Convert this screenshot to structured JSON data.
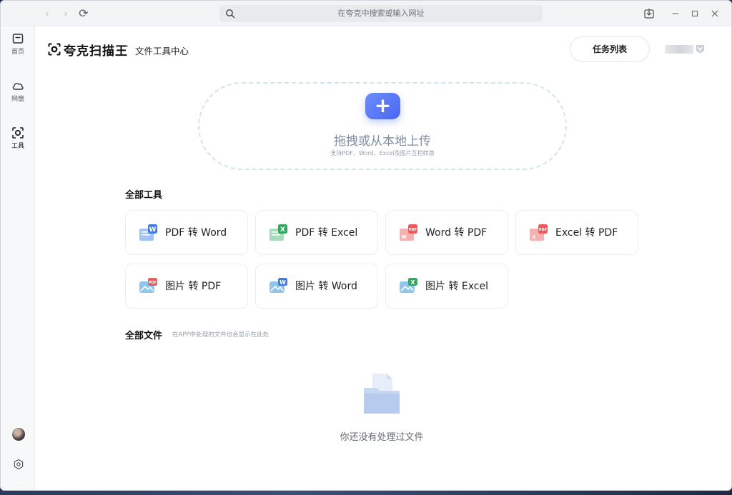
{
  "titlebar": {
    "back_glyph": "‹",
    "forward_glyph": "›",
    "refresh_glyph": "⟳",
    "search_placeholder": "在夸克中搜索或输入网址"
  },
  "rail": {
    "items": [
      {
        "label": "首页",
        "icon": "home-icon"
      },
      {
        "label": "网盘",
        "icon": "cloud-icon"
      },
      {
        "label": "工具",
        "icon": "scan-icon"
      }
    ]
  },
  "header": {
    "brand": "夸克扫描王",
    "separator": "•",
    "subtitle": "文件工具中心",
    "task_button": "任务列表"
  },
  "upload": {
    "plus_glyph": "+",
    "title": "拖拽或从本地上传",
    "hint": "支持PDF、Word、Excel及图片互相转换"
  },
  "tools": {
    "heading": "全部工具",
    "items": [
      {
        "label": "PDF 转 Word",
        "icon": "pdf-to-word-icon"
      },
      {
        "label": "PDF 转 Excel",
        "icon": "pdf-to-excel-icon"
      },
      {
        "label": "Word 转 PDF",
        "icon": "word-to-pdf-icon"
      },
      {
        "label": "Excel 转 PDF",
        "icon": "excel-to-pdf-icon"
      },
      {
        "label": "图片 转 PDF",
        "icon": "image-to-pdf-icon"
      },
      {
        "label": "图片 转 Word",
        "icon": "image-to-word-icon"
      },
      {
        "label": "图片 转 Excel",
        "icon": "image-to-excel-icon"
      }
    ]
  },
  "files": {
    "heading": "全部文件",
    "note": "在APP中处理的文件也会显示在此处",
    "empty_text": "你还没有处理过文件"
  },
  "colors": {
    "accent": "#5b78f6",
    "word_blue": "#3f7be8",
    "excel_green": "#2eaa5c",
    "pdf_red": "#ef5a5a"
  }
}
